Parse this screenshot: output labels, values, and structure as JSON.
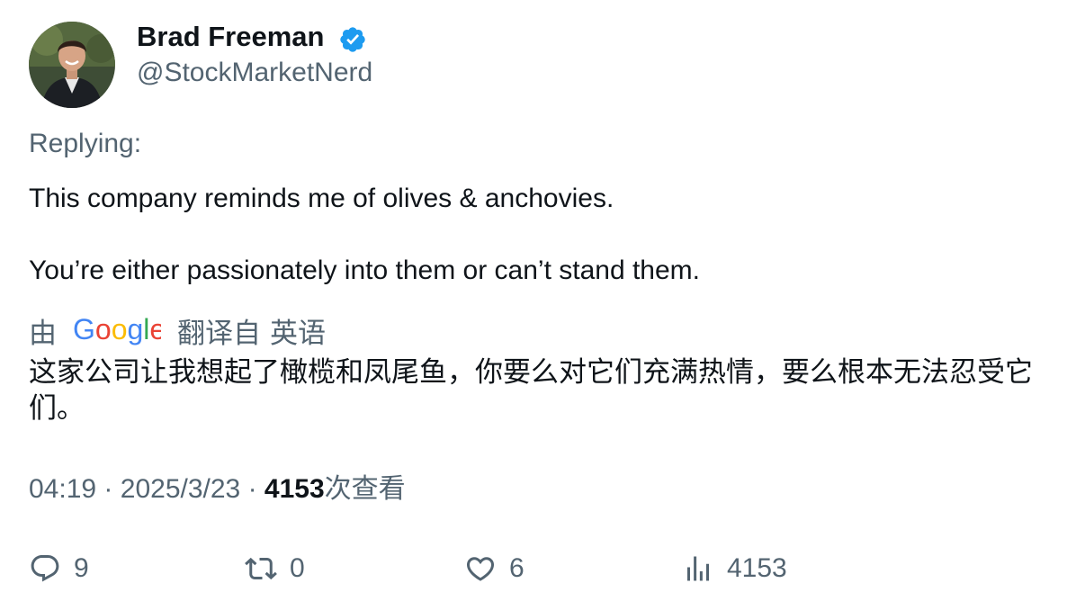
{
  "author": {
    "display_name": "Brad Freeman",
    "handle": "@StockMarketNerd",
    "verified": true,
    "verified_color": "#1d9bf0"
  },
  "replying_label": "Replying:",
  "tweet": {
    "lines": [
      "This company reminds me of olives & anchovies.",
      "You’re either passionately into them or can’t stand them."
    ]
  },
  "translation": {
    "by_label": "由",
    "provider": "Google",
    "translated_from_label": "翻译自",
    "source_language": "英语",
    "text": "这家公司让我想起了橄榄和凤尾鱼，你要么对它们充满热情，要么根本无法忍受它们。"
  },
  "meta": {
    "time": "04:19",
    "separator": "·",
    "date": "2025/3/23",
    "views_count": "4153",
    "views_label": "次查看"
  },
  "actions": {
    "replies": "9",
    "retweets": "0",
    "likes": "6",
    "views": "4153"
  },
  "colors": {
    "text_primary": "#0f1419",
    "text_secondary": "#536471",
    "google_blue": "#4285F4",
    "google_red": "#EA4335",
    "google_yellow": "#FBBC05",
    "google_green": "#34A853"
  },
  "icons": [
    "verified-badge-icon",
    "reply-icon",
    "retweet-icon",
    "like-icon",
    "views-icon"
  ]
}
